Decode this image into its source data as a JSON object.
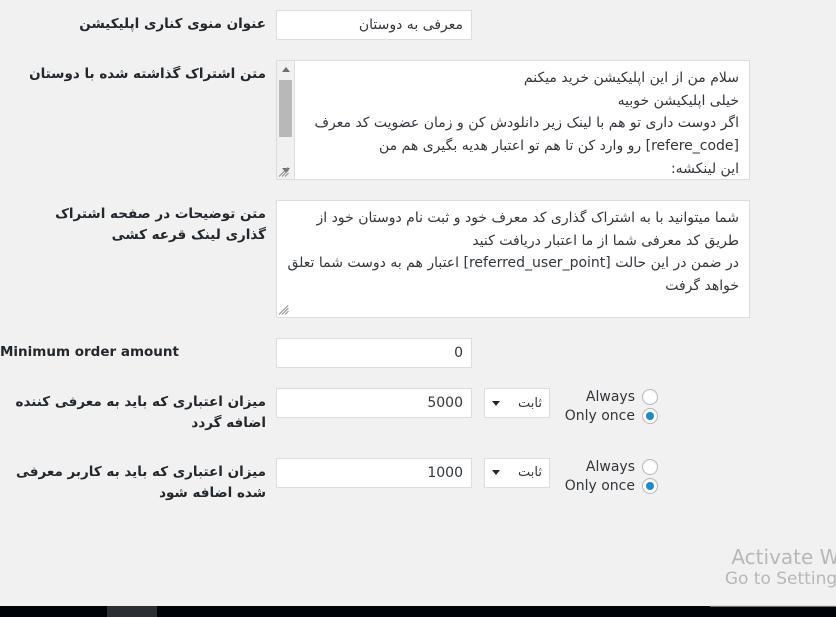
{
  "page": {
    "background_color": "#f1f1f1",
    "text_color": "#23282d",
    "accent_color": "#1e8cbe"
  },
  "rows": [
    {
      "label": "عنوان منوی کناری اپلیکیشن",
      "input_value": "معرفی به دوستان"
    },
    {
      "label": "متن اشتراک گذاشته شده با دوستان",
      "textarea_value": "سلام من از این اپلیکیشن خرید میکنم\nخیلی اپلیکیشن خوبیه\nاگر دوست داری تو هم با لینک زیر دانلودش کن و زمان عضویت کد معرف [refere_code] رو وارد کن تا هم تو اعتبار هدیه بگیری هم من\nاین لینکشه:"
    },
    {
      "label": "متن توضیحات در صفحه اشتراک گذاری لینک قرعه کشی",
      "textarea_value": "شما میتوانید با به اشتراک گذاری کد معرف خود و ثبت نام دوستان خود از طریق کد معرفی شما از ما اعتبار دریافت کنید\nدر ضمن در این حالت [referred_user_point] اعتبار هم به دوست شما تعلق خواهد گرفت"
    },
    {
      "label": "Minimum order amount",
      "input_value": "0"
    },
    {
      "label": "میزان اعتباری که باید به معرفی کننده اضافه گردد",
      "input_value": "5000",
      "select_value": "ثابت",
      "radios": [
        {
          "label": "Always",
          "checked": false
        },
        {
          "label": "Only once",
          "checked": true
        }
      ]
    },
    {
      "label": "میزان اعتباری که باید به کاربر معرفی شده اضافه شود",
      "input_value": "1000",
      "select_value": "ثابت",
      "radios": [
        {
          "label": "Always",
          "checked": false
        },
        {
          "label": "Only once",
          "checked": true
        }
      ]
    }
  ],
  "watermark": {
    "line1": "Activate W",
    "line2": "Go to Settings"
  }
}
